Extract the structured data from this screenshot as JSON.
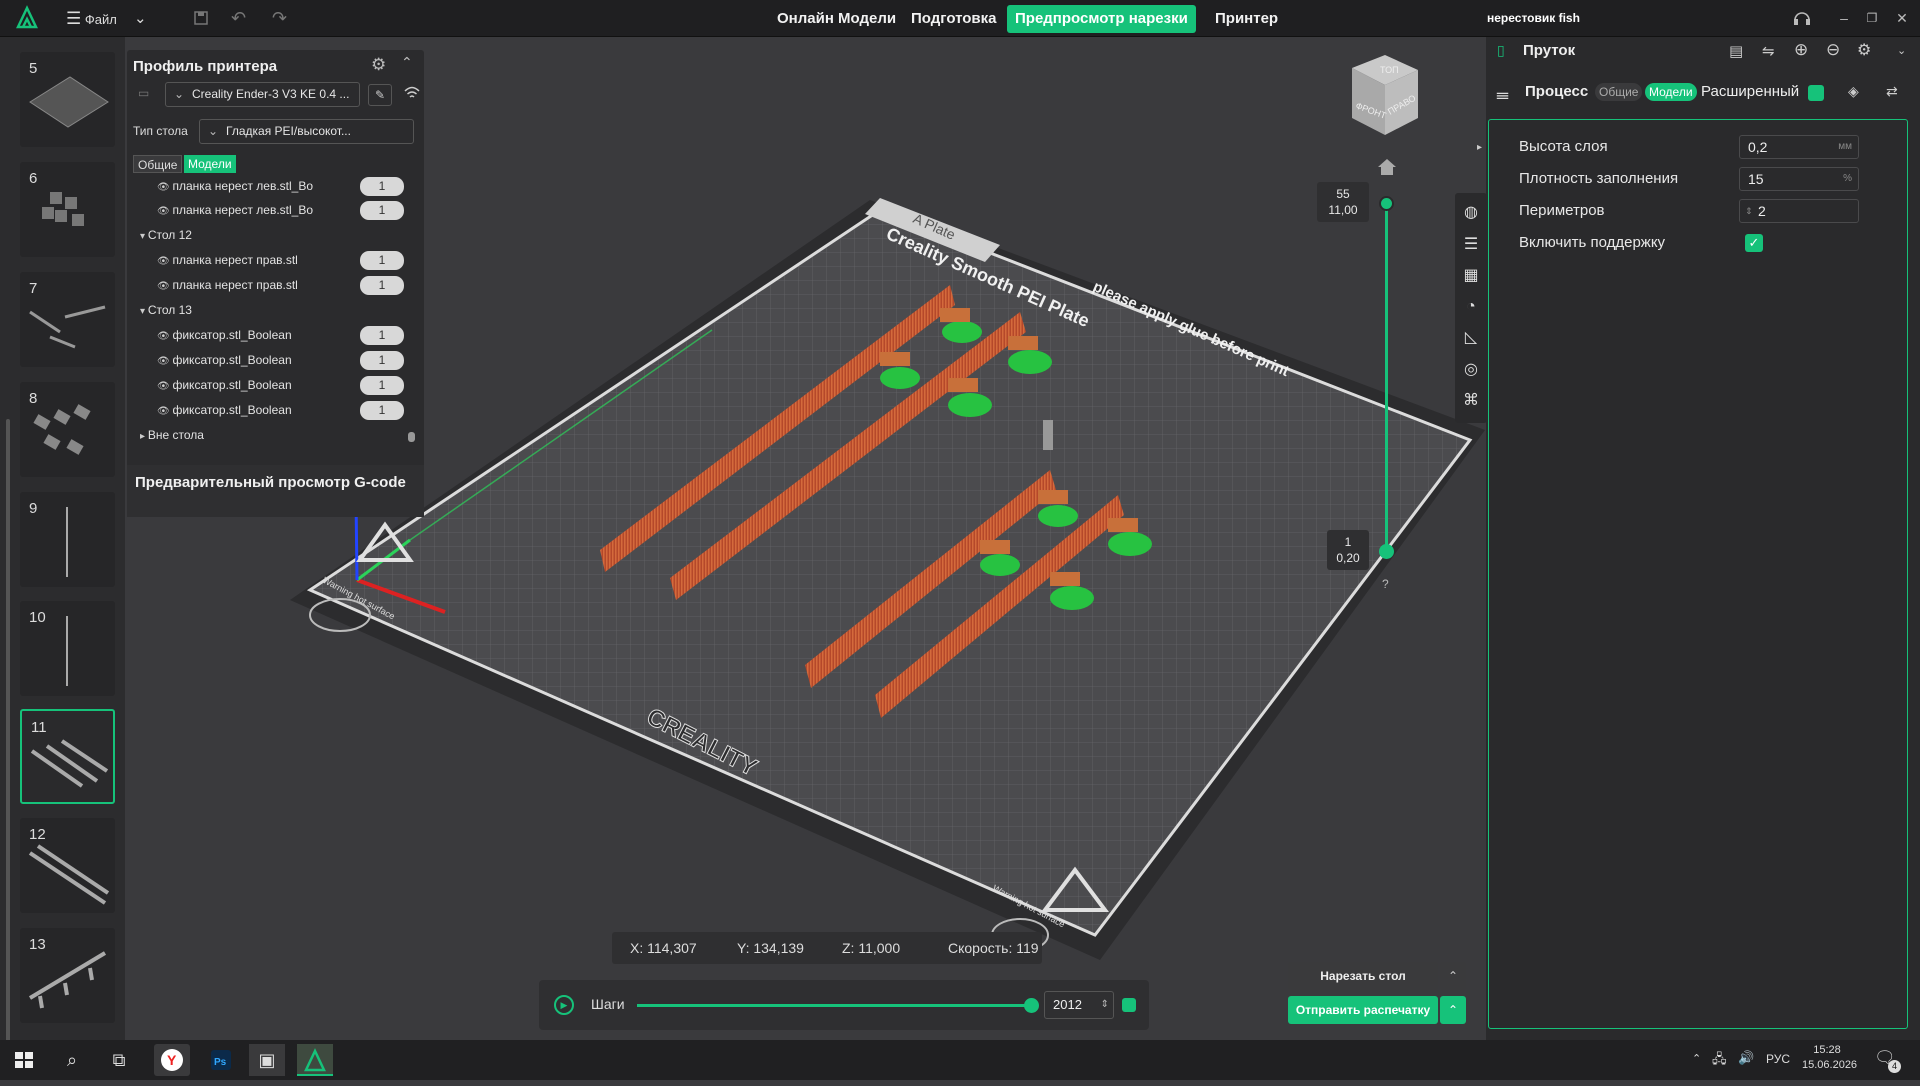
{
  "app": {
    "menu_label": "Файл",
    "project_name": "нерестовик fish",
    "tabs": [
      "Онлайн Модели",
      "Подготовка",
      "Предпросмотр нарезки",
      "Принтер"
    ],
    "active_tab": "Предпросмотр нарезки",
    "accent_color": "#16c27a"
  },
  "thumbnails": [
    {
      "num": "5"
    },
    {
      "num": "6"
    },
    {
      "num": "7"
    },
    {
      "num": "8"
    },
    {
      "num": "9"
    },
    {
      "num": "10"
    },
    {
      "num": "11",
      "selected": true
    },
    {
      "num": "12"
    },
    {
      "num": "13"
    }
  ],
  "printer_panel": {
    "title": "Профиль принтера",
    "printer": "Creality Ender-3 V3 KE 0.4 ...",
    "bed_label": "Тип стола",
    "bed_value": "Гладкая PEI/высокот...",
    "seg_general": "Общие",
    "seg_models": "Модели",
    "tree": [
      {
        "label": "планка нерест лев.stl_Bo",
        "count": "1"
      },
      {
        "label": "планка нерест лев.stl_Bo",
        "count": "1"
      },
      {
        "label": "Стол 12",
        "group": true
      },
      {
        "label": "планка нерест прав.stl",
        "count": "1"
      },
      {
        "label": "планка нерест прав.stl",
        "count": "1"
      },
      {
        "label": "Стол 13",
        "group": true
      },
      {
        "label": "фиксатор.stl_Boolean",
        "count": "1"
      },
      {
        "label": "фиксатор.stl_Boolean",
        "count": "1"
      },
      {
        "label": "фиксатор.stl_Boolean",
        "count": "1"
      },
      {
        "label": "фиксатор.stl_Boolean",
        "count": "1"
      },
      {
        "label": "Вне стола",
        "group": true,
        "collapsed": true
      }
    ],
    "gcode_title": "Предварительный просмотр G-code"
  },
  "right_panel": {
    "filament_title": "Пруток",
    "process_title": "Процесс",
    "seg_general": "Общие",
    "seg_models": "Модели",
    "advanced_label": "Расширенный",
    "params": [
      {
        "label": "Высота слоя",
        "value": "0,2",
        "unit": "мм"
      },
      {
        "label": "Плотность заполнения",
        "value": "15",
        "unit": "%"
      },
      {
        "label": "Периметров",
        "value": "2",
        "unit": ""
      }
    ],
    "support_label": "Включить поддержку",
    "support_checked": true
  },
  "viewport": {
    "plate_label": "A Plate",
    "plate_brand": "Creality Smooth PEI Plate",
    "plate_note": "please apply glue before print",
    "bed_logo": "CREALITY",
    "warning_text": "Warning hot surface",
    "cube_top": "ТОП",
    "cube_front": "ФРОНТ",
    "cube_right": "ПРАВО",
    "layer_top_num": "55",
    "layer_top_height": "11,00",
    "layer_bottom_num": "1",
    "layer_bottom_height": "0,20",
    "help": "?"
  },
  "status": {
    "x": "X: 114,307",
    "y": "Y: 134,139",
    "z": "Z: 11,000",
    "speed": "Скорость: 119"
  },
  "playback": {
    "steps_label": "Шаги",
    "step_value": "2012",
    "progress": 1.0
  },
  "actions": {
    "slice_label": "Нарезать стол",
    "send_label": "Отправить распечатку"
  },
  "taskbar": {
    "lang": "РУС",
    "time": "15:28",
    "date": "15.06.2026",
    "notif_count": "4"
  }
}
